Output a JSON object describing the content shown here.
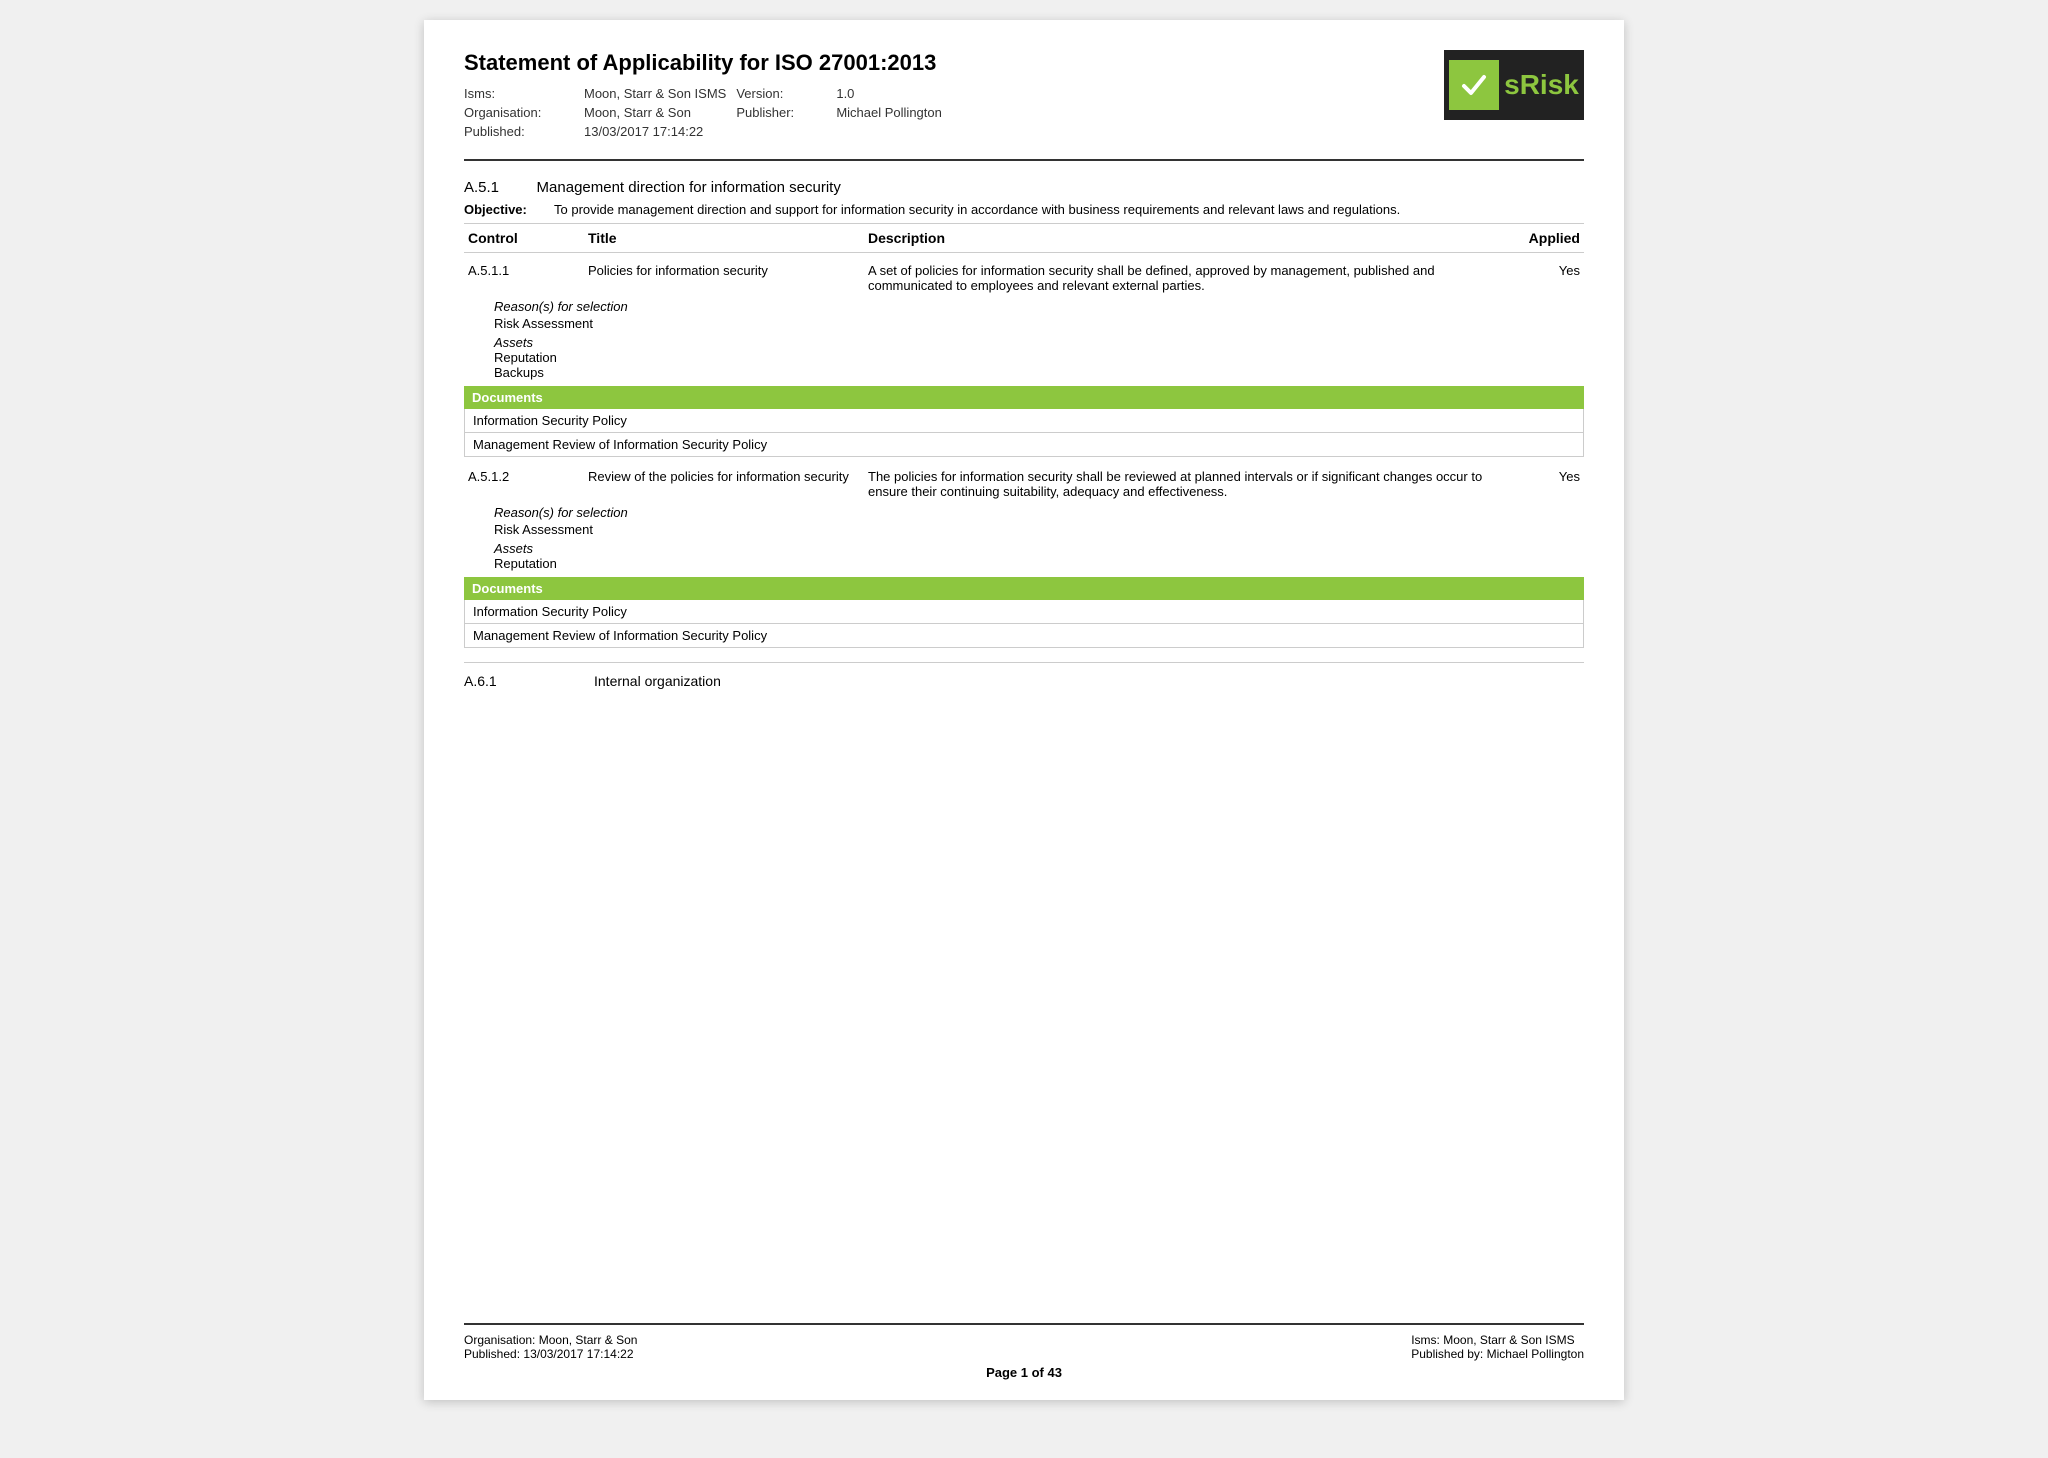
{
  "page": {
    "title": "Statement of Applicability for ISO 27001:2013",
    "isms_label": "Isms:",
    "isms_value": "Moon, Starr & Son ISMS",
    "org_label": "Organisation:",
    "org_value": "Moon, Starr & Son",
    "published_label": "Published:",
    "published_value": "13/03/2017 17:14:22",
    "version_label": "Version:",
    "version_value": "1.0",
    "publisher_label": "Publisher:",
    "publisher_value": "Michael Pollington"
  },
  "logo": {
    "text": "VsRisk"
  },
  "sections": [
    {
      "id": "A.5.1",
      "title": "Management direction for information security",
      "objective_label": "Objective:",
      "objective_text": "To provide management direction and support for information security in accordance with business requirements and relevant laws and regulations.",
      "table_headers": {
        "control": "Control",
        "title": "Title",
        "description": "Description",
        "applied": "Applied"
      },
      "controls": [
        {
          "id": "A.5.1.1",
          "title": "Policies for information security",
          "description": "A set of policies for information security shall be defined, approved by management, published and communicated to employees and relevant external parties.",
          "applied": "Yes",
          "reasons_label": "Reason(s) for selection",
          "reasons": [
            "Risk Assessment"
          ],
          "assets_label": "Assets",
          "assets": [
            "Reputation",
            "Backups"
          ],
          "documents_label": "Documents",
          "documents": [
            "Information Security Policy",
            "Management Review of Information Security Policy"
          ]
        },
        {
          "id": "A.5.1.2",
          "title": "Review of the policies for information security",
          "description": "The policies for information security shall be reviewed at planned intervals or if significant changes occur to ensure their continuing suitability, adequacy and effectiveness.",
          "applied": "Yes",
          "reasons_label": "Reason(s) for selection",
          "reasons": [
            "Risk Assessment"
          ],
          "assets_label": "Assets",
          "assets": [
            "Reputation"
          ],
          "documents_label": "Documents",
          "documents": [
            "Information Security Policy",
            "Management Review of Information Security Policy"
          ]
        }
      ]
    }
  ],
  "a6_section": {
    "id": "A.6.1",
    "title": "Internal organization"
  },
  "footer": {
    "org_label": "Organisation:",
    "org_value": "Moon, Starr & Son",
    "isms_label": "Isms: ",
    "isms_value": "Moon, Starr & Son ISMS",
    "published_label": "Published:",
    "published_value": "13/03/2017 17:14:22",
    "published_by_label": "Published by:",
    "published_by_value": "Michael Pollington",
    "page_info": "Page 1 of 43"
  }
}
